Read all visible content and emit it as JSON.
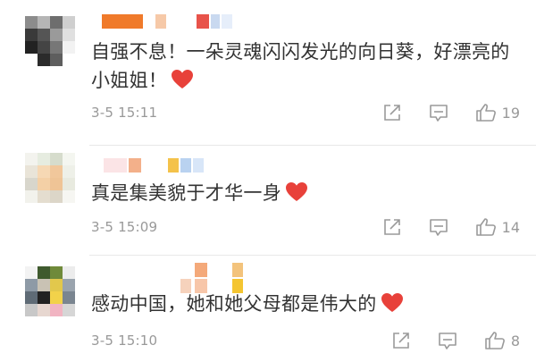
{
  "comments": [
    {
      "text": "自强不息！一朵灵魂闪闪发光的向日葵，好漂亮的小姐姐！",
      "timestamp": "3-5 15:11",
      "likes": "19",
      "emoji": "red-heart"
    },
    {
      "text": "真是集美貌于才华一身",
      "timestamp": "3-5 15:09",
      "likes": "14",
      "emoji": "red-heart"
    },
    {
      "text": "感动中国，她和她父母都是伟大的",
      "timestamp": "3-5 15:10",
      "likes": "8",
      "emoji": "red-heart"
    }
  ],
  "icons": {
    "share": "share-icon",
    "reply": "comment-reply-icon",
    "like": "thumbs-up-icon",
    "heart": "red-heart-emoji"
  },
  "colors": {
    "text": "#333333",
    "meta": "#999999",
    "heart": "#e8413a",
    "icon": "#9a9a9a"
  }
}
